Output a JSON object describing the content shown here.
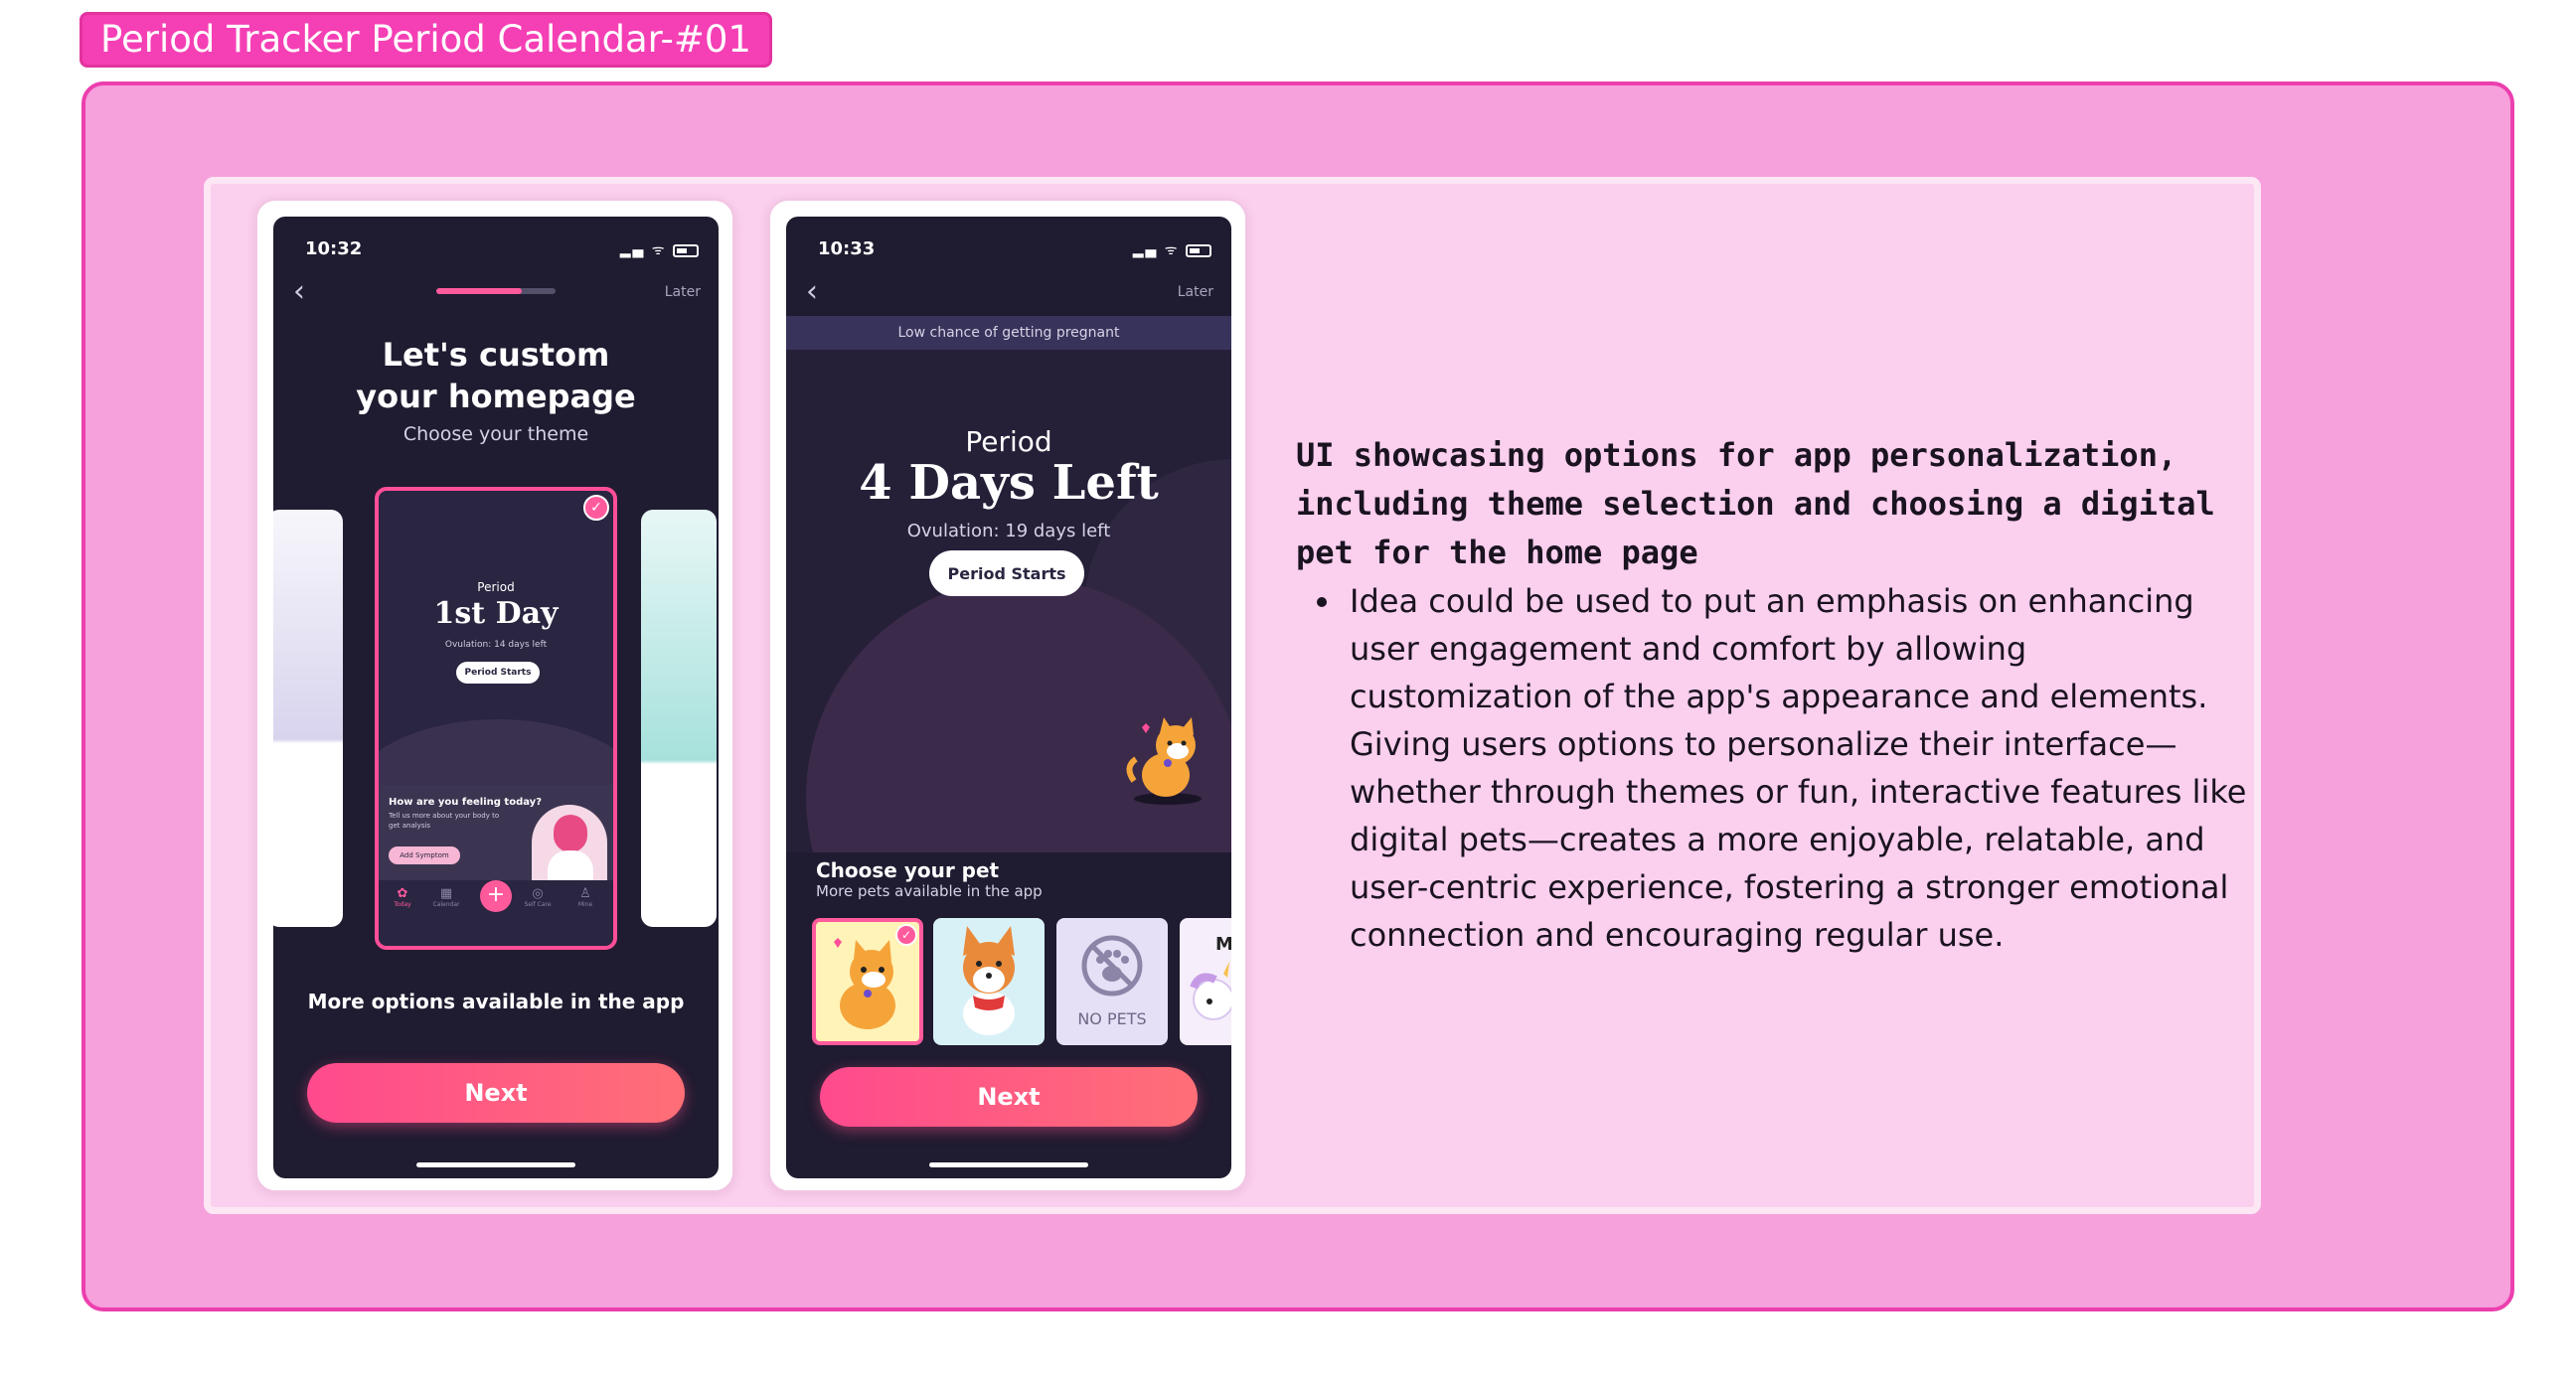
{
  "frame": {
    "title": "Period Tracker Period Calendar-#01"
  },
  "colors": {
    "accent": "#ff5a9c",
    "frame_bg": "#f6a0dc",
    "panel_bg": "#fbcfee",
    "screen_bg": "#1f1b30"
  },
  "screen1": {
    "time": "10:32",
    "later": "Later",
    "progress": 0.72,
    "title_line1": "Let's custom",
    "title_line2": "your homepage",
    "subtitle": "Choose your theme",
    "theme_preview": {
      "period": "Period",
      "day": "1st Day",
      "ovulation": "Ovulation: 14 days left",
      "button": "Period Starts",
      "question": "How are you feeling today?",
      "hint": "Tell us more about your body to get analysis",
      "symptom": "Add Symptom",
      "nav": [
        "Today",
        "Calendar",
        "Self Care",
        "Mine"
      ]
    },
    "more_options": "More options available in the app",
    "next": "Next"
  },
  "screen2": {
    "time": "10:33",
    "later": "Later",
    "banner": "Low chance of getting pregnant",
    "period": "Period",
    "days_left": "4 Days Left",
    "ovulation": "Ovulation: 19 days left",
    "button": "Period Starts",
    "choose_title": "Choose your pet",
    "choose_sub": "More pets available in the app",
    "pets": [
      "cat",
      "corgi",
      "NO PETS",
      "unicorn"
    ],
    "next": "Next"
  },
  "description": {
    "title": "UI showcasing options for app personalization, including theme selection and choosing a digital pet for the home page",
    "bullet": "Idea could be used to put an emphasis on  enhancing user engagement and comfort by allowing customization of the app's appearance and elements. Giving users options to personalize their interface—whether through themes or fun, interactive features like digital pets—creates a more enjoyable, relatable, and user-centric experience, fostering a stronger emotional connection and encouraging regular use."
  }
}
